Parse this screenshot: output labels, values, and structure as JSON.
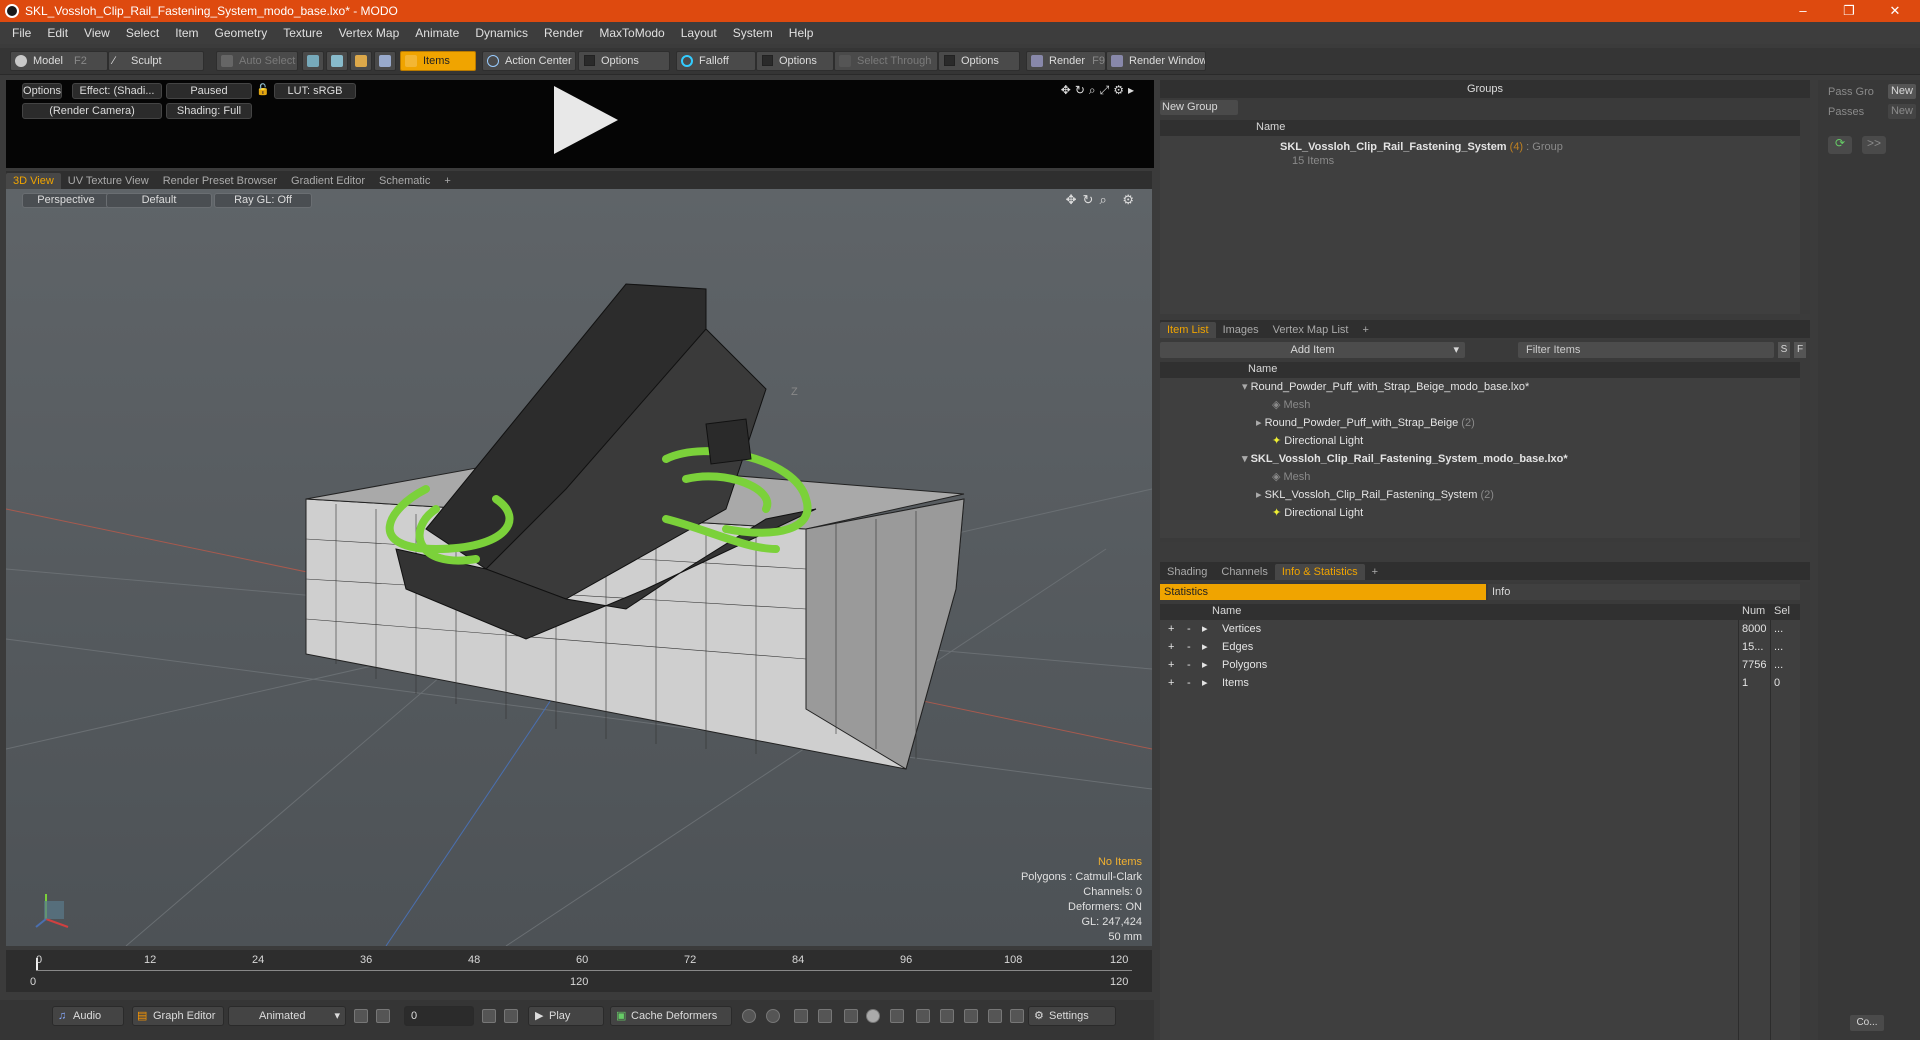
{
  "window": {
    "title": "SKL_Vossloh_Clip_Rail_Fastening_System_modo_base.lxo* - MODO",
    "minimize": "–",
    "maximize": "❐",
    "close": "✕"
  },
  "menu": [
    "File",
    "Edit",
    "View",
    "Select",
    "Item",
    "Geometry",
    "Texture",
    "Vertex Map",
    "Animate",
    "Dynamics",
    "Render",
    "MaxToModo",
    "Layout",
    "System",
    "Help"
  ],
  "toolbar": {
    "model": "Model",
    "model_key": "F2",
    "sculpt": "Sculpt",
    "auto_select": "Auto Select",
    "items": "Items",
    "action_center": "Action Center",
    "options1": "Options",
    "falloff": "Falloff",
    "options2": "Options",
    "select_through": "Select Through",
    "options3": "Options",
    "render": "Render",
    "render_key": "F9",
    "render_window": "Render Window"
  },
  "preview": {
    "options": "Options",
    "effect": "Effect: (Shadi...",
    "paused": "Paused",
    "lut": "LUT: sRGB",
    "camera": "(Render Camera)",
    "shading": "Shading: Full"
  },
  "view_tabs": [
    "3D View",
    "UV Texture View",
    "Render Preset Browser",
    "Gradient Editor",
    "Schematic",
    "+"
  ],
  "viewport": {
    "perspective": "Perspective",
    "default": "Default",
    "raygl": "Ray GL: Off",
    "axis_label": "Z",
    "hud": {
      "no_items": "No Items",
      "polygons": "Polygons : Catmull-Clark",
      "channels": "Channels: 0",
      "deformers": "Deformers: ON",
      "gl": "GL: 247,424",
      "mm": "50 mm"
    }
  },
  "timeline": {
    "ticks_top": [
      "0",
      "12",
      "24",
      "36",
      "48",
      "60",
      "72",
      "84",
      "96",
      "108",
      "120"
    ],
    "ticks_bottom_left": "0",
    "ticks_bottom_mid": "120",
    "ticks_bottom_right": "120"
  },
  "bottombar": {
    "audio": "Audio",
    "graph_editor": "Graph Editor",
    "animated": "Animated",
    "frame": "0",
    "play": "Play",
    "cache": "Cache Deformers",
    "settings": "Settings"
  },
  "groups": {
    "title": "Groups",
    "new_group": "New Group",
    "col_name": "Name",
    "group_name": "SKL_Vossloh_Clip_Rail_Fastening_System",
    "group_count": "(4)",
    "group_type": ": Group",
    "items_count": "15 Items"
  },
  "pass": {
    "pass_gro": "Pass Gro",
    "passes": "Passes",
    "new1": "New",
    "new2": "New",
    "arrows": ">>",
    "co": "Co..."
  },
  "itemlist": {
    "tabs": [
      "Item List",
      "Images",
      "Vertex Map List",
      "+"
    ],
    "add_item": "Add Item",
    "filter": "Filter Items",
    "s": "S",
    "f": "F",
    "col_name": "Name",
    "rows": [
      {
        "label": "Round_Powder_Puff_with_Strap_Beige_modo_base.lxo*",
        "count": ""
      },
      {
        "label": "Mesh",
        "count": ""
      },
      {
        "label": "Round_Powder_Puff_with_Strap_Beige",
        "count": "(2)"
      },
      {
        "label": "Directional Light",
        "count": ""
      },
      {
        "label": "SKL_Vossloh_Clip_Rail_Fastening_System_modo_base.lxo*",
        "count": ""
      },
      {
        "label": "Mesh",
        "count": ""
      },
      {
        "label": "SKL_Vossloh_Clip_Rail_Fastening_System",
        "count": "(2)"
      },
      {
        "label": "Directional Light",
        "count": ""
      }
    ]
  },
  "stats": {
    "tabs": [
      "Shading",
      "Channels",
      "Info & Statistics",
      "+"
    ],
    "statistics": "Statistics",
    "info": "Info",
    "col_name": "Name",
    "col_num": "Num",
    "col_sel": "Sel",
    "rows": [
      {
        "name": "Vertices",
        "num": "8000",
        "sel": "..."
      },
      {
        "name": "Edges",
        "num": "15...",
        "sel": "..."
      },
      {
        "name": "Polygons",
        "num": "7756",
        "sel": "..."
      },
      {
        "name": "Items",
        "num": "1",
        "sel": "0"
      }
    ]
  }
}
